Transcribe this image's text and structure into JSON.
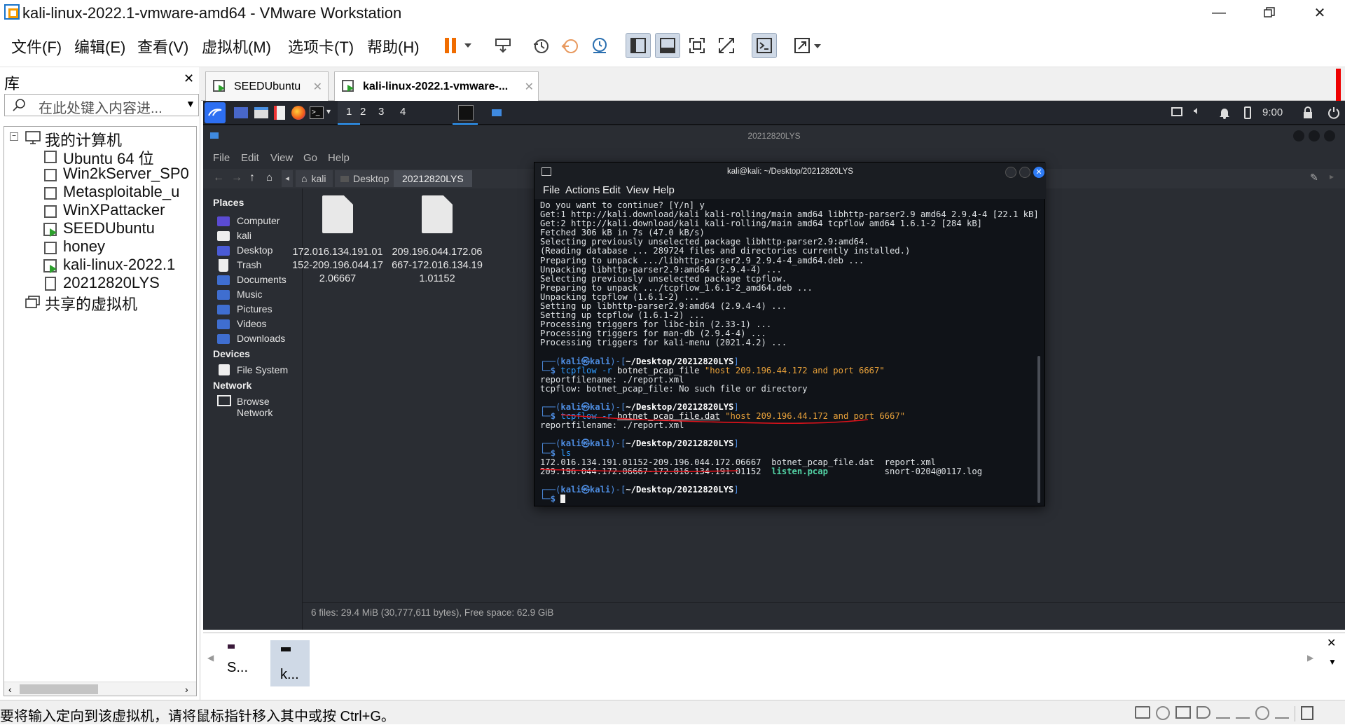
{
  "window": {
    "title": "kali-linux-2022.1-vmware-amd64 - VMware Workstation"
  },
  "menu": {
    "file": "文件(F)",
    "edit": "编辑(E)",
    "view": "查看(V)",
    "vm": "虚拟机(M)",
    "tabs": "选项卡(T)",
    "help": "帮助(H)"
  },
  "library": {
    "title": "库",
    "search_placeholder": "在此处键入内容进...",
    "root": "我的计算机",
    "vms": [
      "Ubuntu 64 位",
      "Win2kServer_SP0",
      "Metasploitable_u",
      "WinXPattacker",
      "SEEDUbuntu",
      "honey",
      "kali-linux-2022.1",
      "20212820LYS"
    ],
    "shared": "共享的虚拟机"
  },
  "vm_tabs": [
    "SEEDUbuntu",
    "kali-linux-2022.1-vmware-..."
  ],
  "kali_panel": {
    "workspaces": [
      "1",
      "2",
      "3",
      "4"
    ],
    "clock": "9:00"
  },
  "file_manager": {
    "window_title": "20212820LYS",
    "menu": [
      "File",
      "Edit",
      "View",
      "Go",
      "Help"
    ],
    "path": [
      "kali",
      "Desktop",
      "20212820LYS"
    ],
    "places_header": "Places",
    "places": [
      "Computer",
      "kali",
      "Desktop",
      "Trash",
      "Documents",
      "Music",
      "Pictures",
      "Videos",
      "Downloads"
    ],
    "devices_header": "Devices",
    "devices": [
      "File System"
    ],
    "network_header": "Network",
    "network": [
      "Browse Network"
    ],
    "files": [
      "172.016.134.191.01152-209.196.044.172.06667",
      "209.196.044.172.06667-172.016.134.191.01152"
    ],
    "status": "6 files: 29.4 MiB (30,777,611 bytes), Free space: 62.9 GiB"
  },
  "terminal": {
    "title": "kali@kali: ~/Desktop/20212820LYS",
    "menu": [
      "File",
      "Actions",
      "Edit",
      "View",
      "Help"
    ],
    "output_lines": [
      "Do you want to continue? [Y/n] y",
      "Get:1 http://kali.download/kali kali-rolling/main amd64 libhttp-parser2.9 amd64 2.9.4-4 [22.1 kB]",
      "Get:2 http://kali.download/kali kali-rolling/main amd64 tcpflow amd64 1.6.1-2 [284 kB]",
      "Fetched 306 kB in 7s (47.0 kB/s)",
      "Selecting previously unselected package libhttp-parser2.9:amd64.",
      "(Reading database ... 289724 files and directories currently installed.)",
      "Preparing to unpack .../libhttp-parser2.9_2.9.4-4_amd64.deb ...",
      "Unpacking libhttp-parser2.9:amd64 (2.9.4-4) ...",
      "Selecting previously unselected package tcpflow.",
      "Preparing to unpack .../tcpflow_1.6.1-2_amd64.deb ...",
      "Unpacking tcpflow (1.6.1-2) ...",
      "Setting up libhttp-parser2.9:amd64 (2.9.4-4) ...",
      "Setting up tcpflow (1.6.1-2) ...",
      "Processing triggers for libc-bin (2.33-1) ...",
      "Processing triggers for man-db (2.9.4-4) ...",
      "Processing triggers for kali-menu (2021.4.2) ..."
    ],
    "prompt_user": "kali",
    "prompt_at": "㉿",
    "prompt_host": "kali",
    "prompt_dir": "~/Desktop/20212820LYS",
    "cmd1": {
      "prog": "tcpflow",
      "flag": "-r",
      "file": "botnet_pcap_file",
      "filter": "\"host 209.196.44.172 and port 6667\""
    },
    "cmd1_out": [
      "reportfilename: ./report.xml",
      "tcpflow: botnet_pcap_file: No such file or directory"
    ],
    "cmd2": {
      "prog": "tcpflow",
      "flag": "-r",
      "file": "botnet_pcap_file.dat",
      "filter": "\"host 209.196.44.172 and port 6667\""
    },
    "cmd2_out": "reportfilename: ./report.xml",
    "cmd3": "ls",
    "ls": {
      "row1": {
        "a": "172.016.134.191.01152-209.196.044.172.06667",
        "b": "botnet_pcap_file.dat",
        "c": "report.xml"
      },
      "row2": {
        "a": "209.196.044.172.06667-172.016.134.191.01152",
        "b": "listen.pcap",
        "c": "snort-0204@0117.log"
      }
    }
  },
  "thumbnails": [
    "S...",
    "k..."
  ],
  "statusbar": {
    "text": "要将输入定向到该虚拟机，请将鼠标指针移入其中或按 Ctrl+G。"
  },
  "colors": {
    "accent": "#2e9bff",
    "annotation": "#e0121a",
    "terminal_bg": "#101318"
  }
}
